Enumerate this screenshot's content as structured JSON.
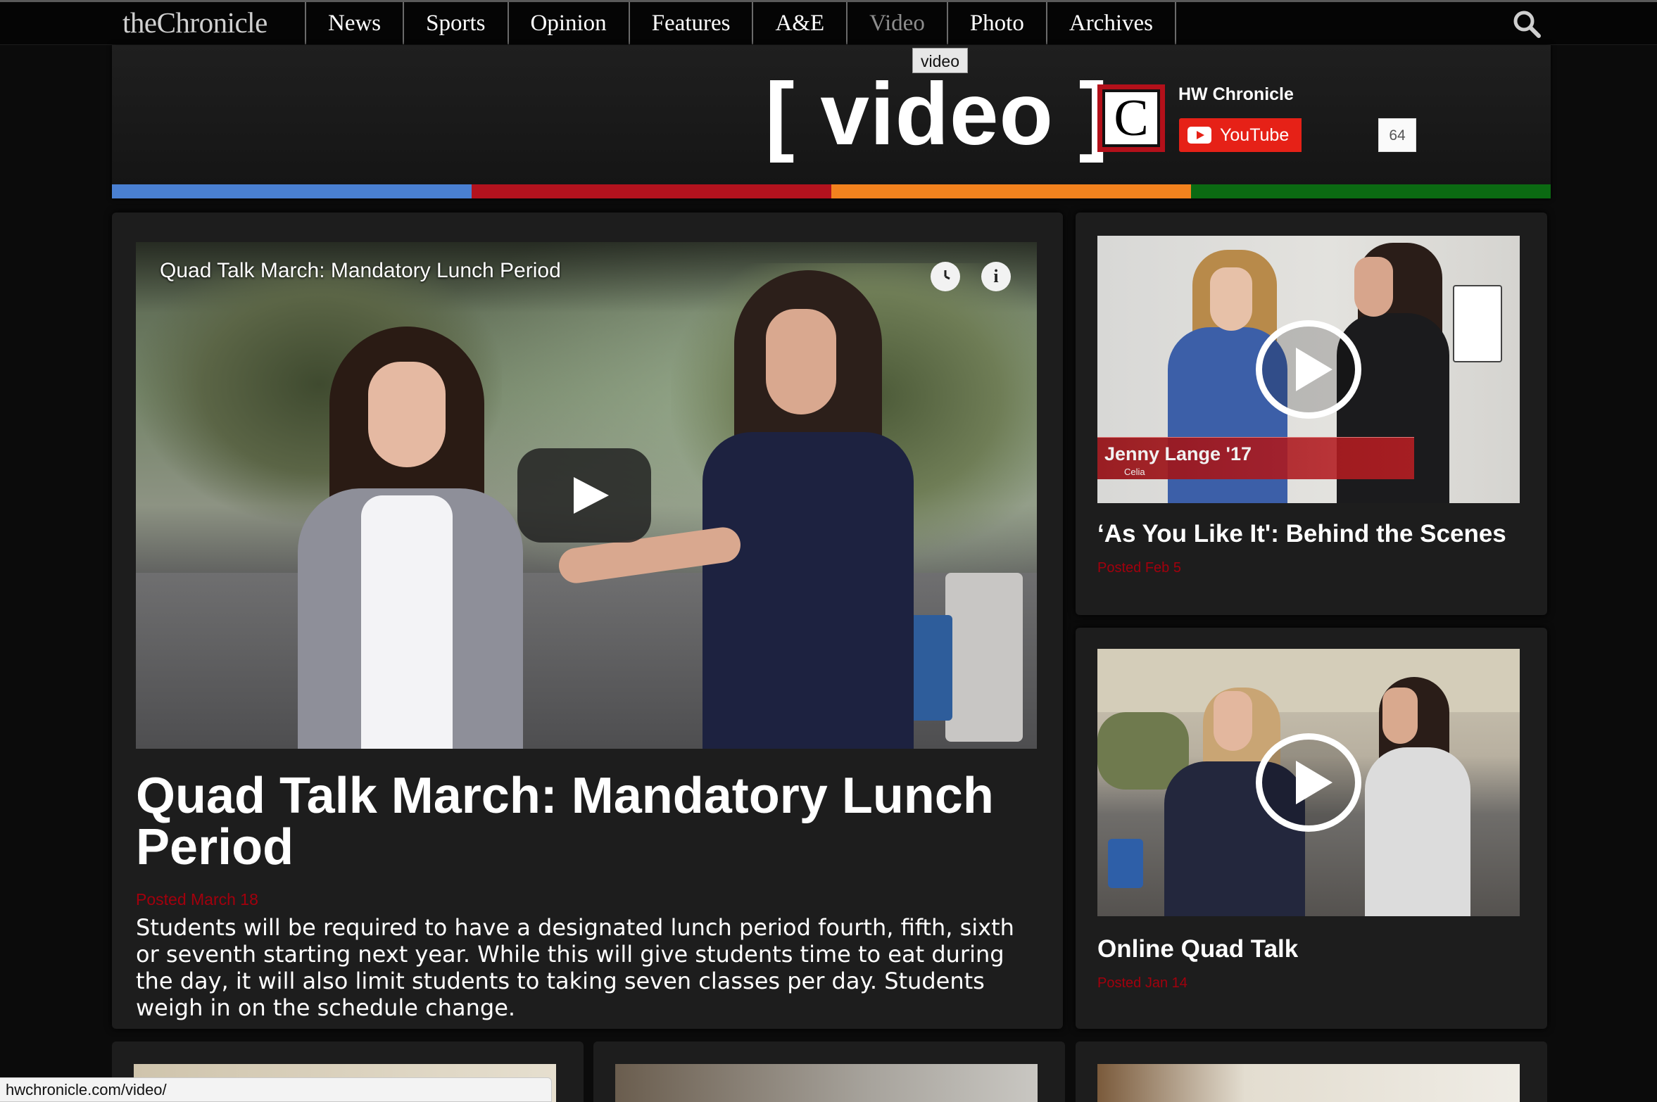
{
  "nav": {
    "brand": "theChronicle",
    "items": [
      {
        "label": "News"
      },
      {
        "label": "Sports"
      },
      {
        "label": "Opinion"
      },
      {
        "label": "Features"
      },
      {
        "label": "A&E"
      },
      {
        "label": "Video"
      },
      {
        "label": "Photo"
      },
      {
        "label": "Archives"
      }
    ],
    "active": "Video",
    "search_icon": "search-icon",
    "tooltip": "video"
  },
  "header": {
    "title": "[ video ]",
    "color_bar": [
      "#4a80d2",
      "#b3121e",
      "#f3821e",
      "#0b6a12"
    ]
  },
  "youtube": {
    "logo_letter": "C",
    "channel": "HW Chronicle",
    "button_label": "YouTube",
    "subscriber_count": "64"
  },
  "featured": {
    "player_title": "Quad Talk March: Mandatory Lunch Period",
    "headline": "Quad Talk March: Mandatory Lunch Period",
    "posted": "Posted March 18",
    "description": "Students will be required to have a designated lunch period fourth, fifth, sixth or seventh starting next year. While this will give students time to eat during the day, it will also limit students to taking seven classes per day. Students weigh in on the schedule change."
  },
  "sidebar": [
    {
      "title": "‘As You Like It': Behind the Scenes",
      "posted": "Posted Feb 5",
      "lower_third_name": "Jenny Lange '17",
      "lower_third_role": "Celia"
    },
    {
      "title": "Online Quad Talk",
      "posted": "Posted Jan 14"
    }
  ],
  "status_bar": {
    "url": "hwchronicle.com/video/"
  },
  "colors": {
    "accent_red": "#a2000d",
    "youtube_red": "#e62117"
  }
}
